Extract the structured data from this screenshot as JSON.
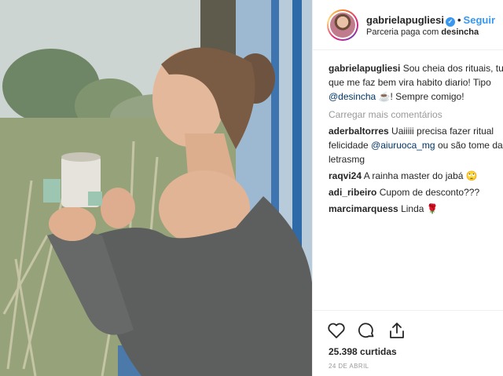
{
  "post": {
    "username": "gabrielapugliesi",
    "follow_label": "Seguir",
    "sponsor_prefix": "Parceria paga com",
    "sponsor_name": "desincha",
    "verified_icon": "verified-badge-icon"
  },
  "caption": {
    "username": "gabrielapugliesi",
    "line1": "Sou cheia dos rituais, tudo",
    "line2": "que me faz bem vira habito diario! Tipo",
    "mention": "@desincha",
    "line3_rest": "! Sempre comigo!",
    "emoji": "☕"
  },
  "load_more_label": "Carregar mais comentários",
  "comments": [
    {
      "user": "aderbaltorres",
      "text": "Uaiiiii precisa fazer ritual",
      "line2_pre": "felicidade ",
      "mention": "@aiuruoca_mg",
      "line2_post": " ou são tome da",
      "line3": "letrasmg"
    },
    {
      "user": "raqvi24",
      "text": "A rainha master do jabá",
      "emoji": "🙄"
    },
    {
      "user": "adi_ribeiro",
      "text": "Cupom de desconto???"
    },
    {
      "user": "marcimarquess",
      "text": "Linda",
      "emoji": "🌹"
    }
  ],
  "likes_label": "25.398 curtidas",
  "date_label": "24 DE ABRIL",
  "icons": [
    "heart-icon",
    "comment-icon",
    "share-icon"
  ]
}
